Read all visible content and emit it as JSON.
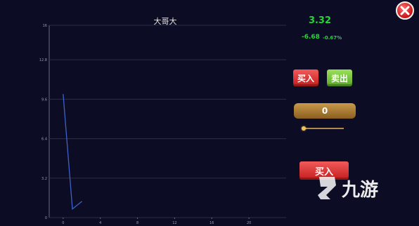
{
  "chart": {
    "title": "大哥大"
  },
  "chart_data": {
    "type": "line",
    "x": [
      0,
      1,
      2
    ],
    "y": [
      10.0,
      0.7,
      1.3
    ],
    "xlim": [
      -1.5,
      24
    ],
    "ylim": [
      0,
      15.6
    ],
    "x_ticks": [
      "0",
      "4",
      "8",
      "12",
      "16",
      "20"
    ],
    "y_ticks": [
      "0",
      "3.2",
      "6.4",
      "9.6",
      "12.8",
      "16"
    ],
    "grid": true,
    "line_color": "#3f62c8"
  },
  "panel": {
    "price": "3.32",
    "change": "-6.68",
    "change_pct": "-0.67%",
    "buy_label": "买入",
    "sell_label": "卖出",
    "quantity": "0",
    "slider_value": 0,
    "big_buy_label": "买入"
  },
  "watermark": {
    "text": "九游"
  },
  "colors": {
    "background": "#0c0c24",
    "price_green": "#22d633",
    "buy_red": "#d42a2a",
    "sell_green": "#76c43a"
  }
}
